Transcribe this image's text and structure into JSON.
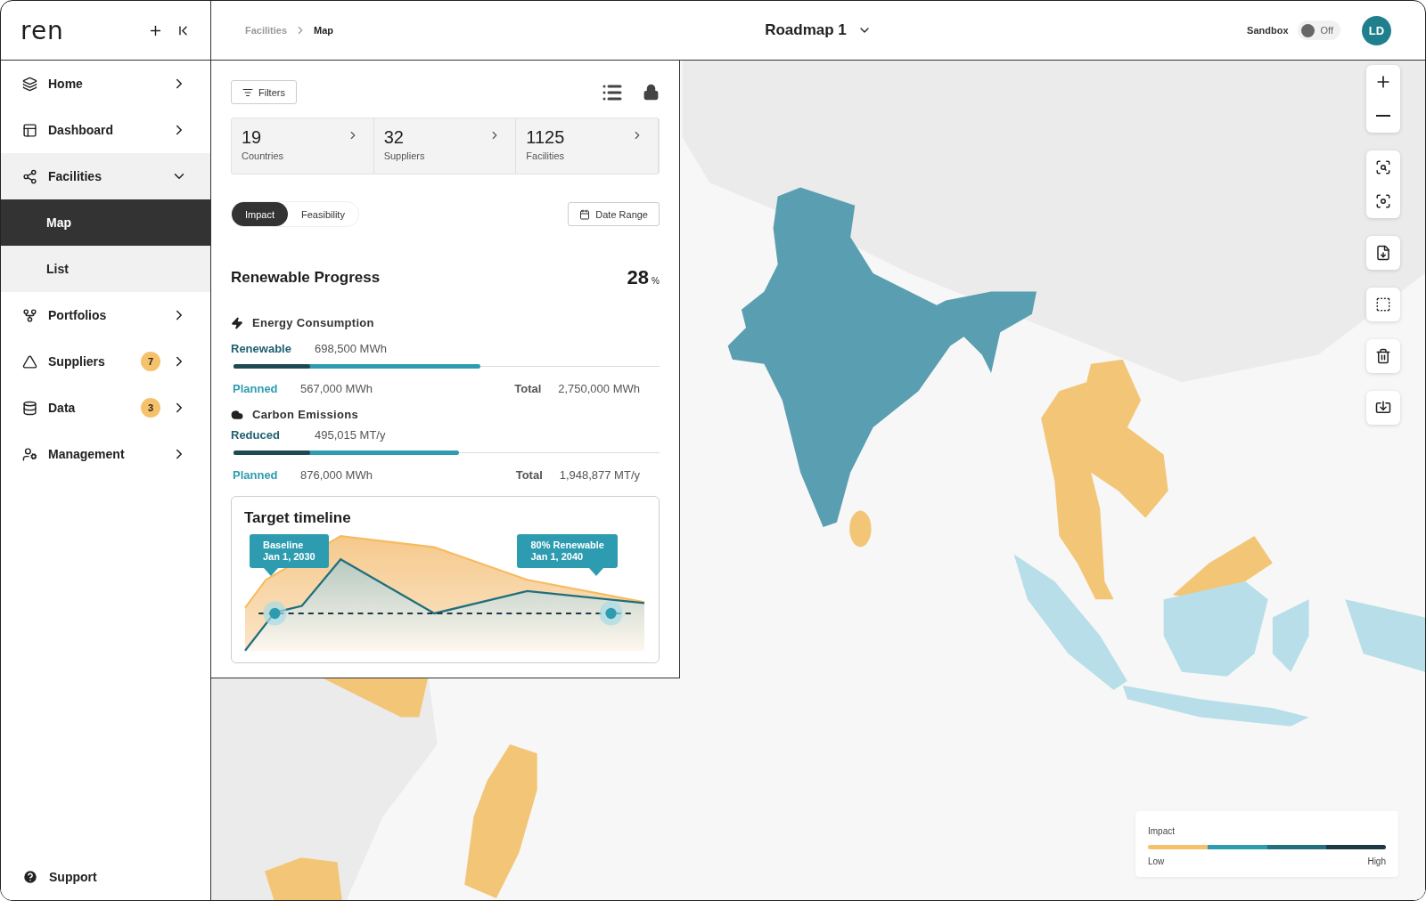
{
  "brand": {
    "logo": "ren"
  },
  "breadcrumb": [
    {
      "label": "Facilities",
      "selected": false
    },
    {
      "label": "Map",
      "selected": true
    }
  ],
  "roadmap": {
    "title": "Roadmap 1"
  },
  "sandbox": {
    "label": "Sandbox",
    "state_label": "Off",
    "on": false
  },
  "user": {
    "initials": "LD"
  },
  "sidebar": {
    "items": [
      {
        "label": "Home",
        "expanded": false,
        "selected": false
      },
      {
        "label": "Dashboard",
        "expanded": false,
        "selected": false
      },
      {
        "label": "Facilities",
        "expanded": true,
        "selected": false,
        "children": [
          {
            "label": "Map",
            "selected": true
          },
          {
            "label": "List",
            "selected": false
          }
        ]
      },
      {
        "label": "Portfolios",
        "expanded": false,
        "selected": false
      },
      {
        "label": "Suppliers",
        "expanded": false,
        "selected": false,
        "badge": "7"
      },
      {
        "label": "Data",
        "expanded": false,
        "selected": false,
        "badge": "3"
      },
      {
        "label": "Management",
        "expanded": false,
        "selected": false
      }
    ],
    "support": "Support"
  },
  "panel": {
    "filters": "Filters",
    "stats": [
      {
        "value": "19",
        "label": "Countries"
      },
      {
        "value": "32",
        "label": "Suppliers"
      },
      {
        "value": "1125",
        "label": "Facilities"
      }
    ],
    "tabs": [
      {
        "label": "Impact",
        "selected": true
      },
      {
        "label": "Feasibility",
        "selected": false
      }
    ],
    "date_range": "Date Range",
    "progress": {
      "title": "Renewable Progress",
      "value": "28",
      "unit": "%"
    },
    "metrics": [
      {
        "title": "Energy Consumption",
        "primary": {
          "label": "Renewable",
          "value": "698,500 MWh",
          "level": 0.18
        },
        "planned": {
          "label": "Planned",
          "value": "567,000 MWh",
          "level": 0.58
        },
        "total": {
          "label": "Total",
          "value": "2,750,000 MWh"
        }
      },
      {
        "title": "Carbon Emissions",
        "primary": {
          "label": "Reduced",
          "value": "495,015 MT/y",
          "level": 0.18
        },
        "planned": {
          "label": "Planned",
          "value": "876,000 MWh",
          "level": 0.53
        },
        "total": {
          "label": "Total",
          "value": "1,948,877 MT/y"
        }
      }
    ],
    "timeline": {
      "title": "Target timeline",
      "markers": [
        {
          "lines": [
            "Baseline",
            "Jan 1, 2030"
          ]
        },
        {
          "lines": [
            "80% Renewable",
            "Jan 1, 2040"
          ]
        }
      ]
    }
  },
  "legend": {
    "title": "Impact",
    "low": "Low",
    "high": "High",
    "segments": [
      {
        "color": "#f5c26b"
      },
      {
        "color": "#2e9cb0"
      },
      {
        "color": "#256f7c"
      },
      {
        "color": "#1d3a44"
      }
    ]
  }
}
